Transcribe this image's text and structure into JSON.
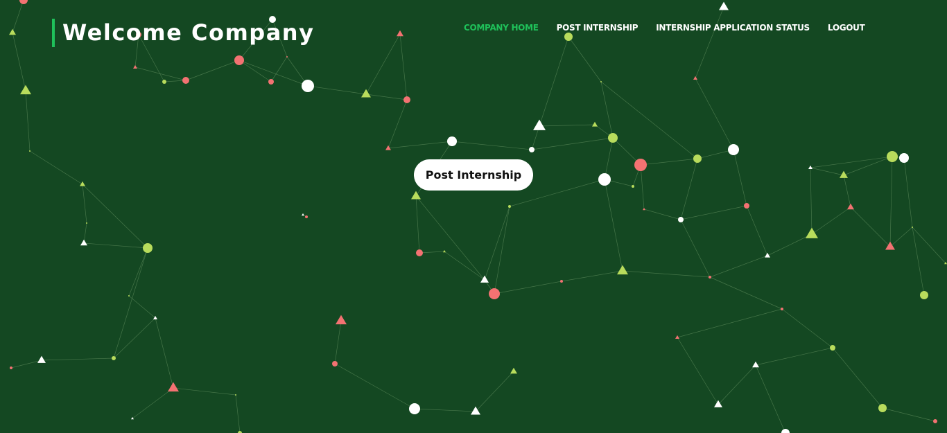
{
  "header": {
    "title": "Welcome Company"
  },
  "nav": {
    "items": [
      {
        "label": "COMPANY HOME",
        "active": true
      },
      {
        "label": "POST INTERNSHIP",
        "active": false
      },
      {
        "label": "INTERNSHIP APPLICATION STATUS",
        "active": false
      },
      {
        "label": "LOGOUT",
        "active": false
      }
    ]
  },
  "hero": {
    "cta_label": "Post Internship"
  },
  "colors": {
    "background": "#144822",
    "accent": "#1fc15a",
    "particle_white": "#ffffff",
    "particle_lime": "#b8dc5c",
    "particle_coral": "#f37272",
    "link_line": "#6f9a6a"
  }
}
